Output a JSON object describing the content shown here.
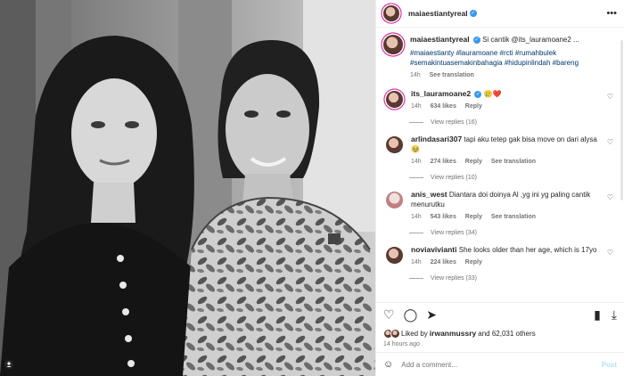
{
  "post": {
    "author": "maiaestiantyreal",
    "caption": {
      "author": "maiaestiantyreal",
      "text": "Si cantik @its_lauramoane2 ...",
      "hashtags": "#maiaestianty #lauramoane #rcti #rumahbulek #semakintuasemakinbahagia #hidupinlindah #bareng",
      "time": "14h",
      "see_translation": "See translation"
    },
    "comments": [
      {
        "user": "its_lauramoane2",
        "verified": true,
        "text": "🥲❤️",
        "time": "14h",
        "likes": "634 likes",
        "reply": "Reply",
        "translation": "",
        "view_replies": "View replies (16)"
      },
      {
        "user": "arlindasari307",
        "verified": false,
        "text": "tapi aku tetep gak bisa move on dari alysa 🥹",
        "time": "14h",
        "likes": "274 likes",
        "reply": "Reply",
        "translation": "See translation",
        "view_replies": "View replies (10)"
      },
      {
        "user": "anis_west",
        "verified": false,
        "text": "Diantara doi doinya Al ,yg ini yg paling cantik menurutku",
        "time": "14h",
        "likes": "543 likes",
        "reply": "Reply",
        "translation": "See translation",
        "view_replies": "View replies (34)"
      },
      {
        "user": "noviavivianti",
        "verified": false,
        "text": "She looks older than her age, which is 17yo",
        "time": "14h",
        "likes": "224 likes",
        "reply": "Reply",
        "translation": "",
        "view_replies": "View replies (33)"
      }
    ],
    "liked_by": {
      "prefix": "Liked by ",
      "user": "irwanmussry",
      "suffix": " and 62,031 others"
    },
    "timestamp": "14 hours ago",
    "add_comment_placeholder": "Add a comment...",
    "post_button": "Post"
  },
  "icons": {
    "more": "more-icon",
    "heart": "heart-icon",
    "comment": "comment-icon",
    "share": "share-icon",
    "save": "bookmark-icon",
    "download": "download-icon",
    "emoji": "emoji-icon",
    "user_tag": "user-tag-icon"
  },
  "colors": {
    "accent": "#3897f0",
    "link": "#00376b",
    "muted": "#737373"
  }
}
